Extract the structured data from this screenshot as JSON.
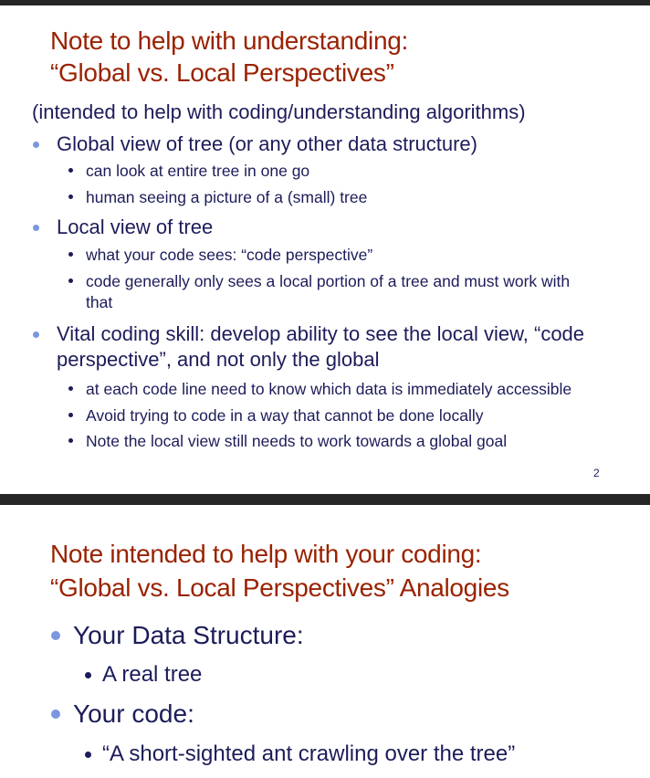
{
  "slide1": {
    "title_line1": "Note to help with understanding:",
    "title_line2": "“Global vs. Local Perspectives”",
    "subtitle": "(intended to help with coding/understanding algorithms)",
    "bullets": [
      {
        "text": "Global view of tree (or any other data structure)",
        "sub": [
          "can look at entire tree in one go",
          "human seeing a picture of a (small) tree"
        ]
      },
      {
        "text": "Local view of tree",
        "sub": [
          "what your code sees: “code perspective”",
          "code generally only sees a local portion of a tree and must work with",
          "that"
        ]
      },
      {
        "text": "Vital coding skill: develop ability to see the local view, “code",
        "text2": "perspective”, and not only the global",
        "sub": [
          "at each code line need to know which data is immediately accessible",
          "Avoid trying to code in a way that cannot be done locally",
          "Note the local view still needs to work towards a global goal"
        ]
      }
    ],
    "page_number": "2"
  },
  "slide2": {
    "title_line1": "Note intended to help with your coding:",
    "title_line2": "“Global vs. Local Perspectives” Analogies",
    "bullets": [
      {
        "text": "Your Data Structure:",
        "sub": [
          "A real tree"
        ]
      },
      {
        "text": "Your code:",
        "sub": [
          "“A short-sighted ant crawling over the tree”"
        ]
      }
    ]
  },
  "colors": {
    "title": "#9a2200",
    "body": "#1c1c5a",
    "bullet": "#7b96e0",
    "divider": "#262626"
  }
}
